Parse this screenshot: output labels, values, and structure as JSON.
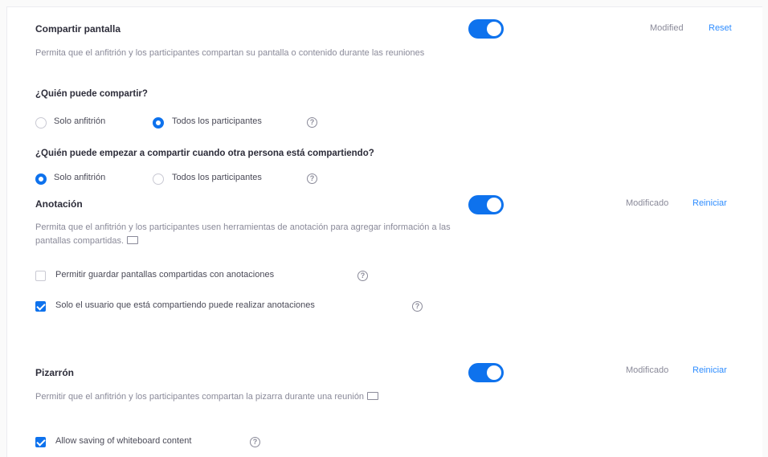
{
  "screen_sharing": {
    "title": "Compartir pantalla",
    "description": "Permita que el anfitrión y los participantes compartan su pantalla o contenido durante las reuniones",
    "status": "Modified",
    "reset_label": "Reset",
    "who_can_share": {
      "question": "¿Quién puede compartir?",
      "options": [
        "Solo anfitrión",
        "Todos los participantes"
      ]
    },
    "who_can_start": {
      "question": "¿Quién puede empezar a compartir cuando otra persona está compartiendo?",
      "options": [
        "Solo anfitrión",
        "Todos los participantes"
      ]
    }
  },
  "annotation": {
    "title": "Anotación",
    "description": "Permita que el anfitrión y los participantes usen herramientas de anotación para agregar información a las pantallas compartidas.",
    "status": "Modificado",
    "reset_label": "Reiniciar",
    "options": [
      "Permitir guardar pantallas compartidas con anotaciones",
      "Solo el usuario que está compartiendo puede realizar anotaciones"
    ]
  },
  "whiteboard": {
    "title": "Pizarrón",
    "description": "Permitir que el anfitrión y los participantes compartan la pizarra durante una reunión",
    "status": "Modificado",
    "reset_label": "Reiniciar",
    "options": [
      "Allow saving of whiteboard content"
    ]
  },
  "help_glyph": "?",
  "colors": {
    "accent": "#0e72ed",
    "link": "#2d8cff",
    "muted": "#8a8a99"
  }
}
